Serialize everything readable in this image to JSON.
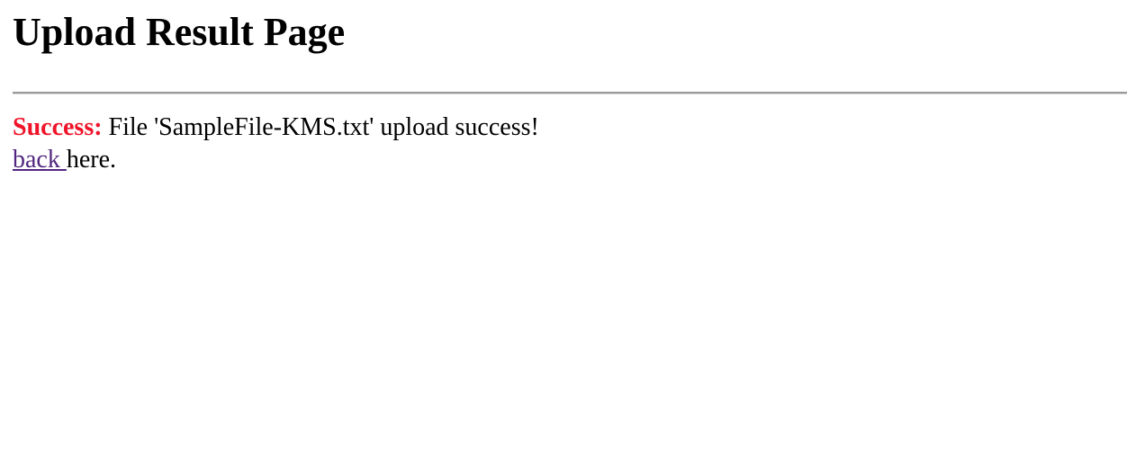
{
  "page": {
    "title": "Upload Result Page"
  },
  "result": {
    "status_label": "Success:",
    "message": " File 'SampleFile-KMS.txt' upload success!"
  },
  "navigation": {
    "back_link_text": "back ",
    "back_suffix": "here."
  },
  "colors": {
    "success": "#f0142a",
    "visited_link": "#52267f",
    "rule": "#9a9a9a"
  }
}
